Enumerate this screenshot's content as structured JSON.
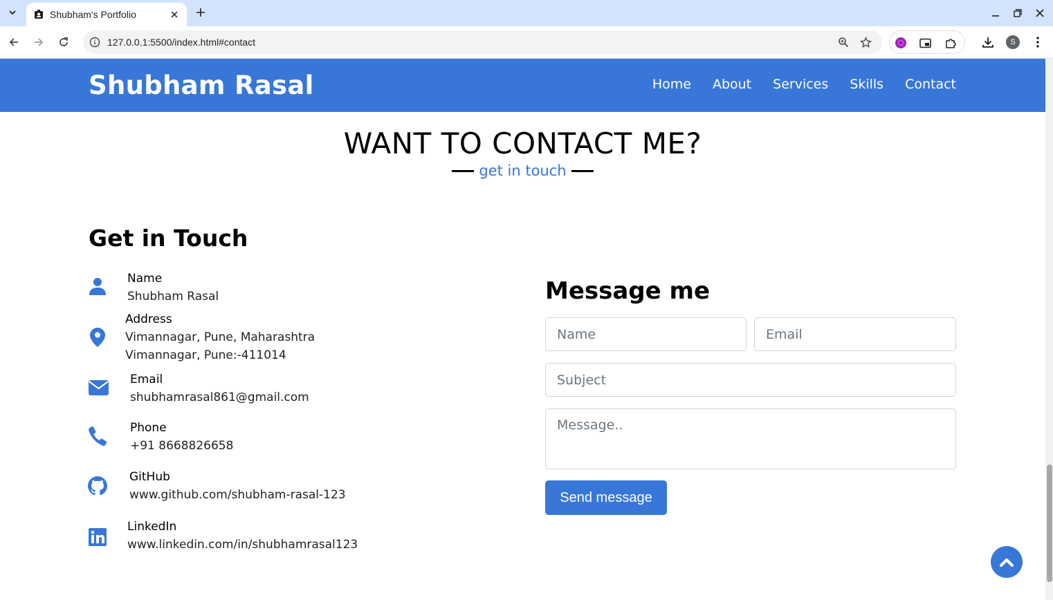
{
  "browser": {
    "tab_title": "Shubham's Portfolio",
    "url": "127.0.0.1:5500/index.html#contact",
    "profile_initial": "S"
  },
  "navbar": {
    "brand": "Shubham Rasal",
    "links": [
      "Home",
      "About",
      "Services",
      "Skills",
      "Contact"
    ]
  },
  "section": {
    "title": "WANT TO CONTACT ME?",
    "subtitle": "get in touch"
  },
  "contact_info": {
    "heading": "Get in Touch",
    "items": [
      {
        "icon": "user-icon",
        "label": "Name",
        "value": "Shubham Rasal"
      },
      {
        "icon": "map-marker-icon",
        "label": "Address",
        "value": "Vimannagar, Pune, Maharashtra\nVimannagar, Pune:-411014"
      },
      {
        "icon": "envelope-icon",
        "label": "Email",
        "value": "shubhamrasal861@gmail.com"
      },
      {
        "icon": "phone-icon",
        "label": "Phone",
        "value": "+91 8668826658"
      },
      {
        "icon": "github-icon",
        "label": "GitHub",
        "value": "www.github.com/shubham-rasal-123"
      },
      {
        "icon": "linkedin-icon",
        "label": "LinkedIn",
        "value": "www.linkedin.com/in/shubhamrasal123"
      }
    ]
  },
  "message_form": {
    "heading": "Message me",
    "name_placeholder": "Name",
    "email_placeholder": "Email",
    "subject_placeholder": "Subject",
    "message_placeholder": "Message..",
    "submit_label": "Send message"
  },
  "colors": {
    "accent": "#3877d8",
    "tabbar": "#d3e3fd"
  }
}
